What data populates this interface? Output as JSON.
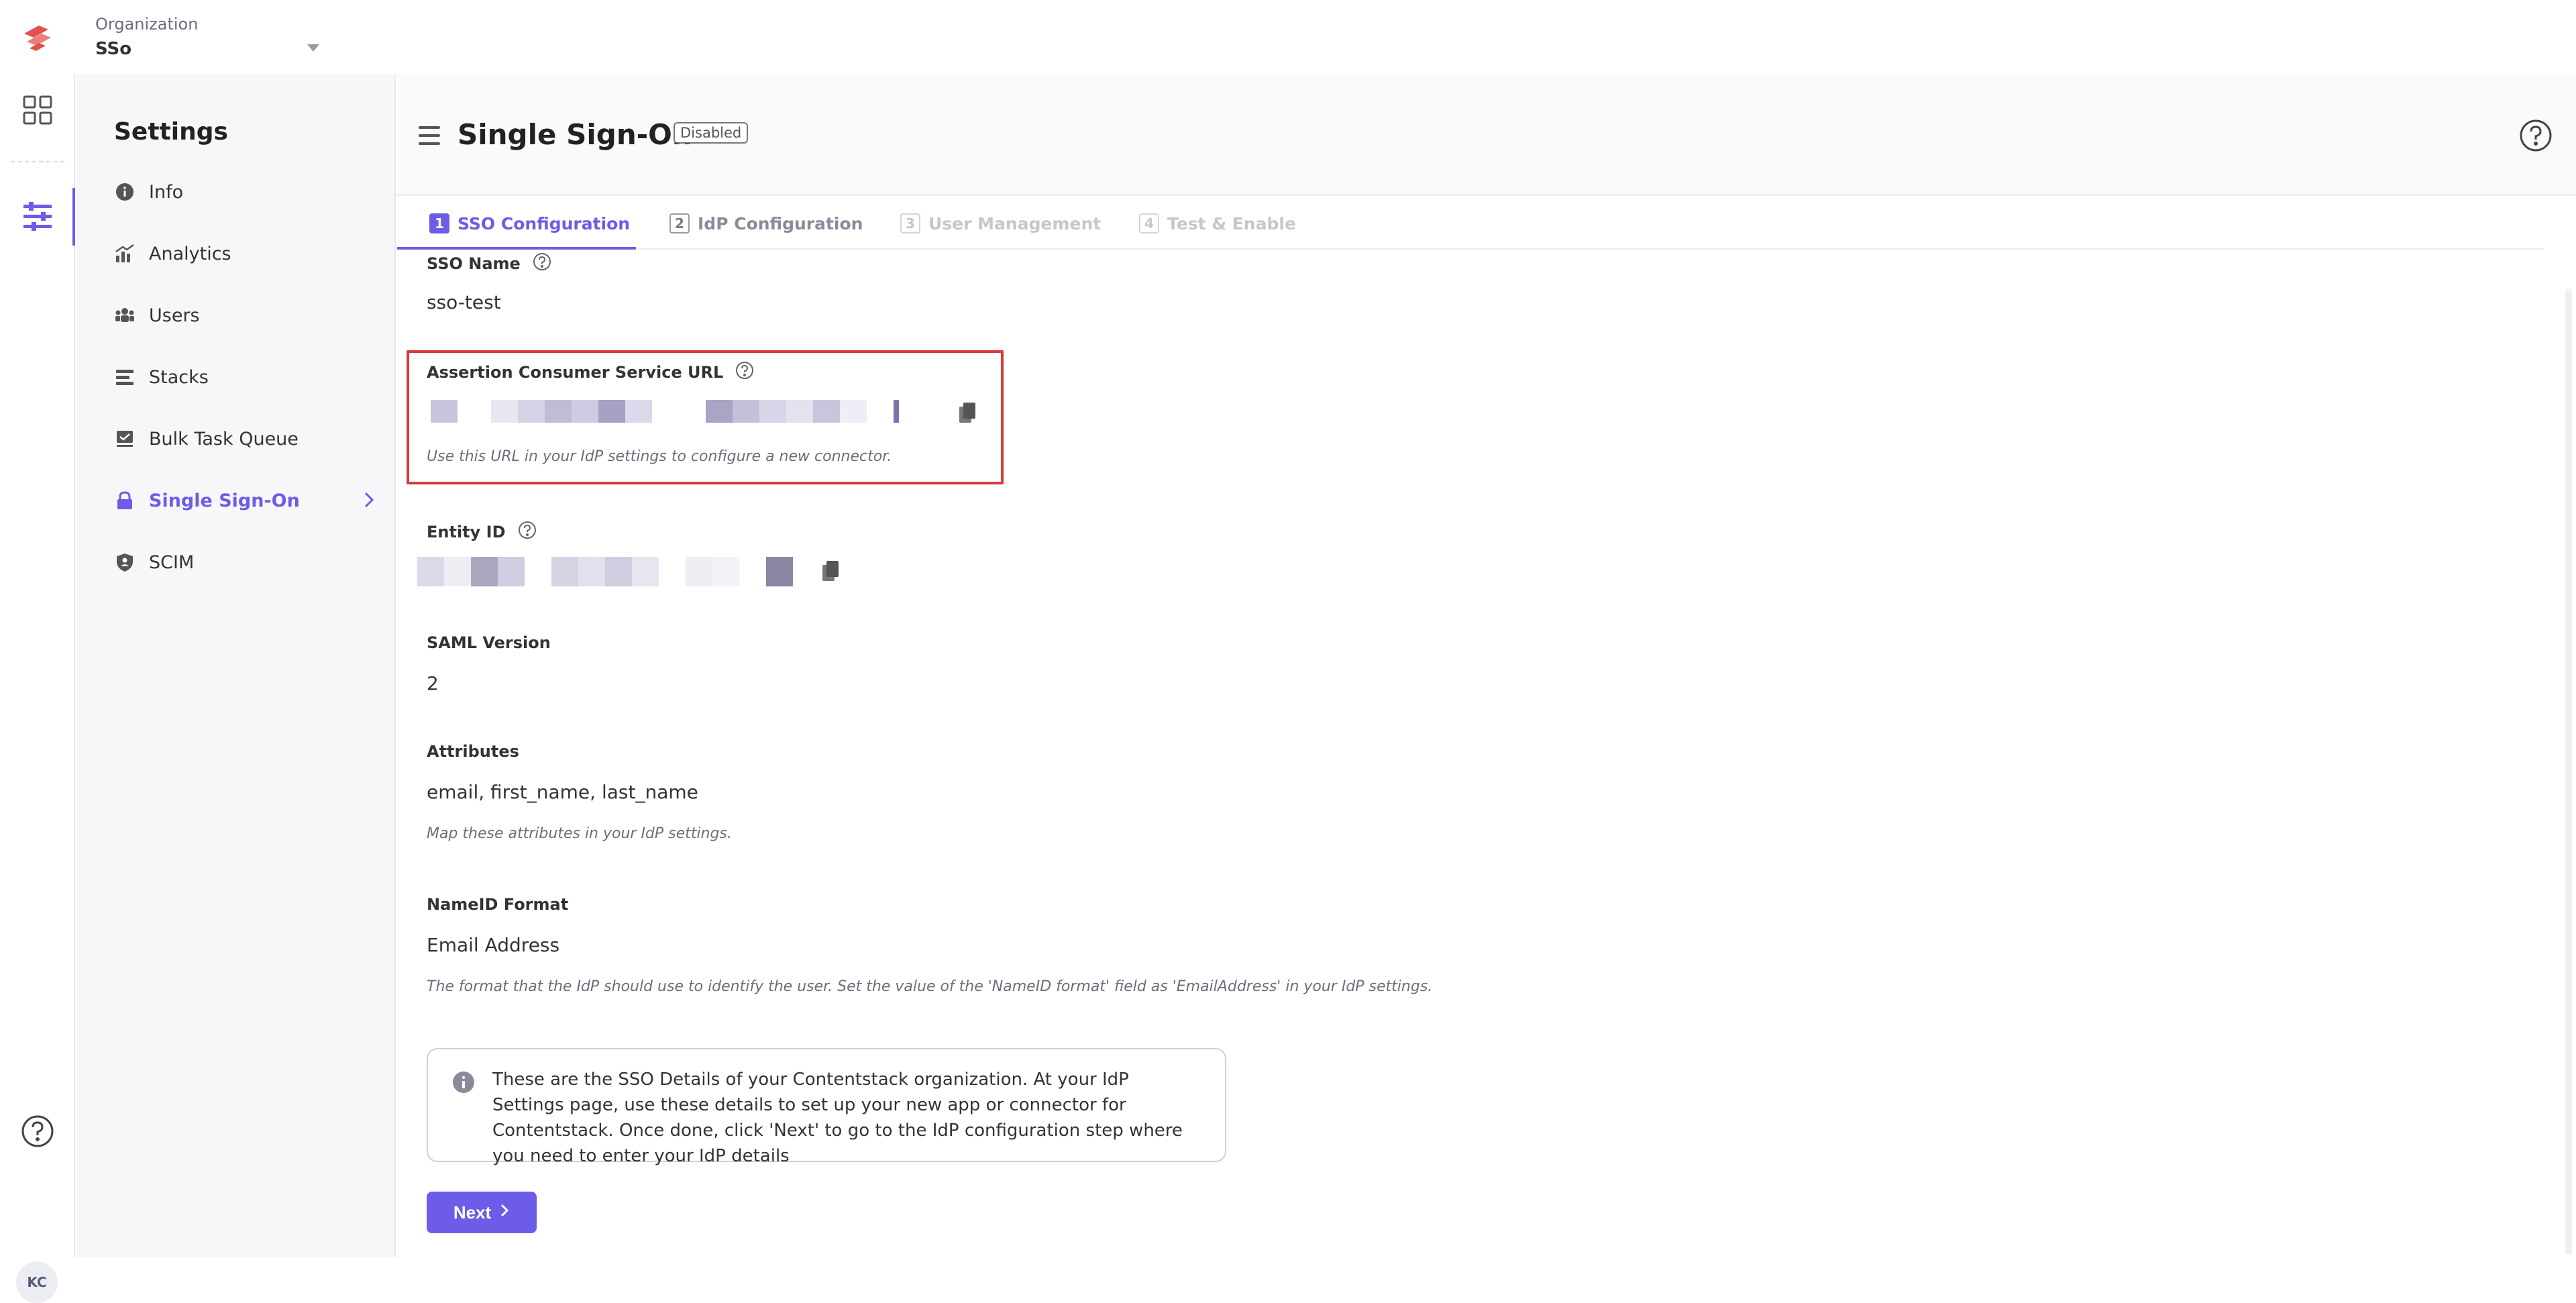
{
  "org": {
    "label": "Organization",
    "value": "SSo"
  },
  "rail": {
    "avatar": "KC"
  },
  "sidebar": {
    "title": "Settings",
    "items": [
      {
        "label": "Info",
        "icon": "info-icon"
      },
      {
        "label": "Analytics",
        "icon": "chart-icon"
      },
      {
        "label": "Users",
        "icon": "users-icon"
      },
      {
        "label": "Stacks",
        "icon": "stack-icon"
      },
      {
        "label": "Bulk Task Queue",
        "icon": "queue-icon"
      },
      {
        "label": "Single Sign-On",
        "icon": "lock-icon"
      },
      {
        "label": "SCIM",
        "icon": "shield-icon"
      }
    ]
  },
  "header": {
    "title": "Single Sign-On",
    "status": "Disabled"
  },
  "tabs": [
    {
      "num": "1",
      "label": "SSO Configuration"
    },
    {
      "num": "2",
      "label": "IdP Configuration"
    },
    {
      "num": "3",
      "label": "User Management"
    },
    {
      "num": "4",
      "label": "Test & Enable"
    }
  ],
  "form": {
    "sso_name": {
      "label": "SSO Name",
      "value": "sso-test"
    },
    "acs_url": {
      "label": "Assertion Consumer Service URL",
      "hint": "Use this URL in your IdP settings to configure a new connector."
    },
    "entity_id": {
      "label": "Entity ID"
    },
    "saml_version": {
      "label": "SAML Version",
      "value": "2"
    },
    "attributes": {
      "label": "Attributes",
      "value": "email, first_name, last_name",
      "hint": "Map these attributes in your IdP settings."
    },
    "nameid_format": {
      "label": "NameID Format",
      "value": "Email Address",
      "hint": "The format that the IdP should use to identify the user. Set the value of the 'NameID format' field as 'EmailAddress' in your IdP settings."
    }
  },
  "info": {
    "text": "These are the SSO Details of your Contentstack organization. At your IdP Settings page, use these details to set up your new app or connector for Contentstack. Once done, click 'Next' to go to the IdP configuration step where you need to enter your IdP details"
  },
  "actions": {
    "next_label": "Next"
  },
  "colors": {
    "accent": "#6c5ce7",
    "highlight_border": "#d63b3b",
    "logo": "#e0524e"
  }
}
